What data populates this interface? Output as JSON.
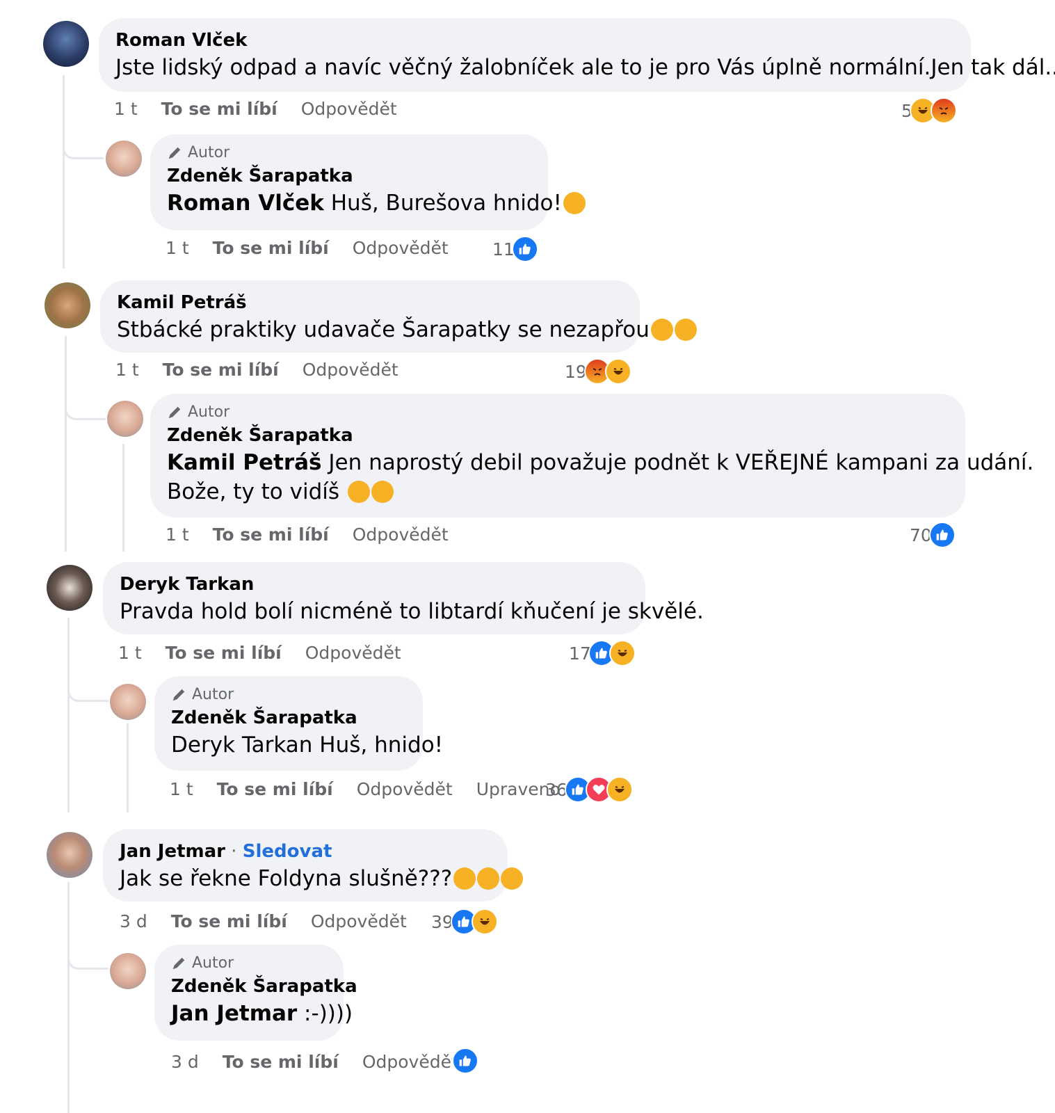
{
  "colors": {
    "bubble": "#f0f2f5",
    "muted": "#65676b",
    "link": "#216fdb",
    "like": "#1877f2",
    "haha": "#f7b125",
    "angry": "#e9710f",
    "love": "#f33e58"
  },
  "author_badge": "Autor",
  "actions": {
    "like": "To se mi líbí",
    "reply": "Odpovědět",
    "edited": "Upraveno"
  },
  "comments": [
    {
      "author": "Roman Vlček",
      "text": "Jste lidský odpad a navíc věčný žalobníček ale to je pro Vás úplně normální.Jen tak dál...",
      "time": "1 t",
      "reactions": {
        "count": "5",
        "icons": [
          "haha-icon",
          "angry-icon"
        ]
      },
      "reply": {
        "author": "Zdeněk Šarapatka",
        "mention": "Roman Vlček",
        "text": " Huš, Burešova hnido!",
        "time": "1 t",
        "reactions": {
          "count": "11",
          "icons": [
            "like-icon"
          ]
        }
      }
    },
    {
      "author": "Kamil Petráš",
      "text": "Stbácké praktiky udavače Šarapatky se nezapřou",
      "time": "1 t",
      "reactions": {
        "count": "19",
        "icons": [
          "angry-icon",
          "haha-icon"
        ]
      },
      "reply": {
        "author": "Zdeněk Šarapatka",
        "mention": "Kamil Petráš",
        "text": " Jen naprostý debil považuje podnět k VEŘEJNÉ kampani za udání.",
        "text2": "Bože, ty to vidíš ",
        "time": "1 t",
        "reactions": {
          "count": "70",
          "icons": [
            "like-icon"
          ]
        }
      }
    },
    {
      "author": "Deryk Tarkan",
      "text": "Pravda hold bolí nicméně to libtardí kňučení je skvělé.",
      "time": "1 t",
      "reactions": {
        "count": "17",
        "icons": [
          "like-icon",
          "haha-icon"
        ]
      },
      "reply": {
        "author": "Zdeněk Šarapatka",
        "text": "Deryk Tarkan Huš, hnido!",
        "time": "1 t",
        "reactions": {
          "count": "36",
          "icons": [
            "like-icon",
            "love-icon",
            "haha-icon"
          ]
        }
      }
    },
    {
      "author": "Jan Jetmar",
      "follow": "Sledovat",
      "text": "Jak se řekne Foldyna slušně???",
      "time": "3 d",
      "reactions": {
        "count": "39",
        "icons": [
          "like-icon",
          "haha-icon"
        ]
      },
      "reply": {
        "author": "Zdeněk Šarapatka",
        "mention": "Jan Jetmar",
        "text": " :-))))",
        "time": "3 d",
        "reactions": {
          "count": "",
          "icons": [
            "like-icon"
          ]
        }
      }
    }
  ]
}
